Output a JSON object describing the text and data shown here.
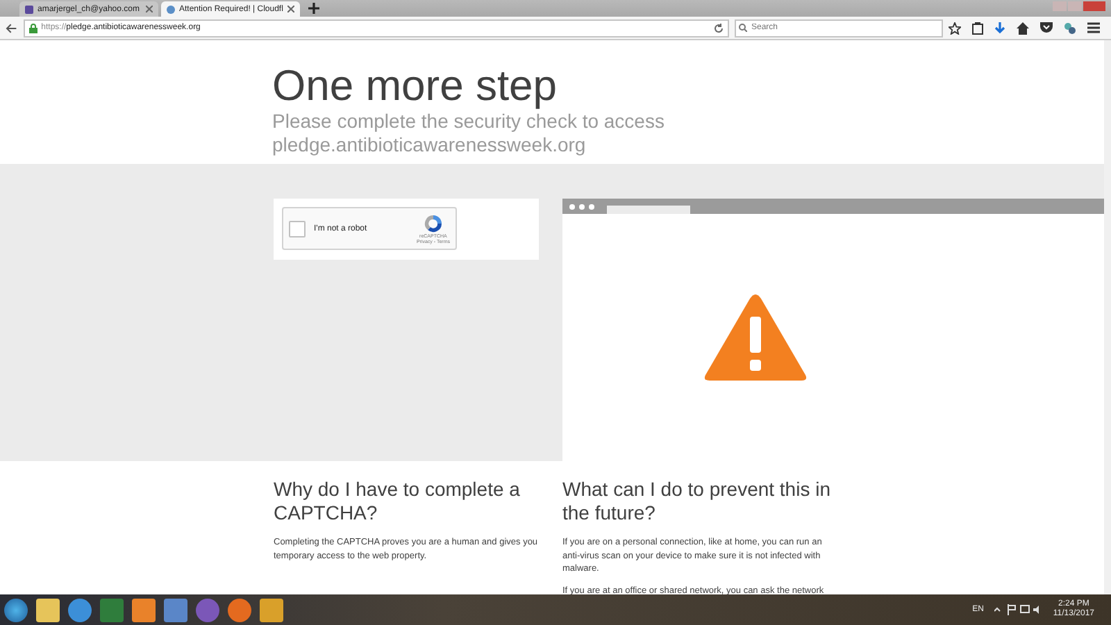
{
  "tabs": [
    {
      "label": "amarjergel_ch@yahoo.com",
      "selected": false
    },
    {
      "label": "Attention Required! | Cloudfl",
      "selected": true
    }
  ],
  "address": {
    "url_prefix": "https://",
    "url_host": "pledge.antibioticawarenessweek.org"
  },
  "search": {
    "placeholder": "Search"
  },
  "page": {
    "title": "One more step",
    "subtitle": "Please complete the security check to access pledge.antibioticawarenessweek.org",
    "captcha": {
      "label": "I'm not a robot",
      "checked": false,
      "brand": "reCAPTCHA",
      "links": "Privacy - Terms"
    },
    "sections": [
      {
        "heading": "Why do I have to complete a CAPTCHA?",
        "paragraphs": [
          "Completing the CAPTCHA proves you are a human and gives you temporary access to the web property."
        ]
      },
      {
        "heading": "What can I do to prevent this in the future?",
        "paragraphs": [
          "If you are on a personal connection, like at home, you can run an anti-virus scan on your device to make sure it is not infected with malware.",
          "If you are at an office or shared network, you can ask the network"
        ]
      }
    ]
  },
  "taskbar": {
    "language": "EN",
    "time": "2:24 PM",
    "date": "11/13/2017"
  }
}
